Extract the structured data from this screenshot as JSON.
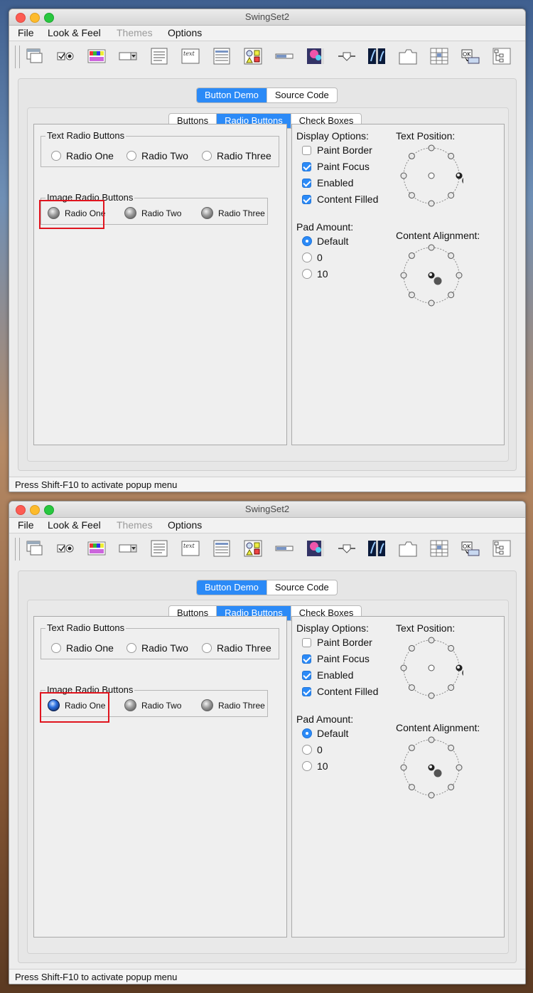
{
  "window": {
    "title": "SwingSet2"
  },
  "menu": {
    "file": "File",
    "look_feel": "Look & Feel",
    "themes": "Themes",
    "options": "Options"
  },
  "toolbar": {
    "icons": [
      "internal-frame-icon",
      "button-icon",
      "color-chooser-icon",
      "combobox-icon",
      "file-chooser-icon",
      "editor-pane-icon",
      "list-icon",
      "option-pane-icon",
      "progress-bar-icon",
      "scroll-pane-icon",
      "slider-icon",
      "split-pane-icon",
      "tabbed-pane-icon",
      "table-icon",
      "tooltip-icon",
      "tree-icon"
    ]
  },
  "demo_tabs": {
    "button_demo": "Button Demo",
    "source_code": "Source Code"
  },
  "sub_tabs": {
    "buttons": "Buttons",
    "radio_buttons": "Radio Buttons",
    "check_boxes": "Check Boxes"
  },
  "text_radio": {
    "title": "Text Radio Buttons",
    "one": "Radio One",
    "two": "Radio Two",
    "three": "Radio Three"
  },
  "image_radio": {
    "title": "Image Radio Buttons",
    "one": "Radio One",
    "two": "Radio Two",
    "three": "Radio Three"
  },
  "display_options": {
    "title": "Display Options:",
    "paint_border": "Paint Border",
    "paint_focus": "Paint Focus",
    "enabled": "Enabled",
    "content_filled": "Content Filled"
  },
  "text_position": {
    "title": "Text Position:"
  },
  "pad_amount": {
    "title": "Pad Amount:",
    "default": "Default",
    "zero": "0",
    "ten": "10"
  },
  "content_alignment": {
    "title": "Content Alignment:"
  },
  "status": {
    "text": "Press Shift-F10 to activate popup menu"
  },
  "states": [
    {
      "image_radio_one_selected": false
    },
    {
      "image_radio_one_selected": true
    }
  ],
  "colors": {
    "accent": "#2b8af7",
    "highlight_box": "#e0141e"
  }
}
